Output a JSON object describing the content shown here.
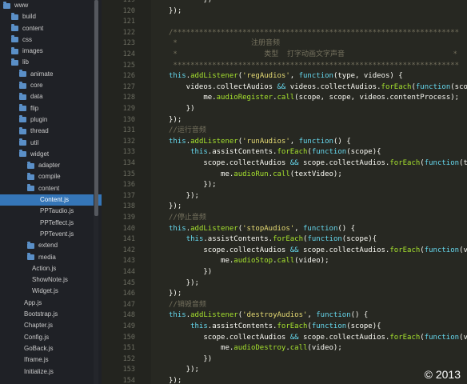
{
  "sidebar": {
    "items": [
      {
        "label": "www",
        "type": "folder",
        "depth": 0,
        "selected": false
      },
      {
        "label": "build",
        "type": "folder",
        "depth": 1,
        "selected": false
      },
      {
        "label": "content",
        "type": "folder",
        "depth": 1,
        "selected": false
      },
      {
        "label": "css",
        "type": "folder",
        "depth": 1,
        "selected": false
      },
      {
        "label": "images",
        "type": "folder",
        "depth": 1,
        "selected": false
      },
      {
        "label": "lib",
        "type": "folder",
        "depth": 1,
        "selected": false
      },
      {
        "label": "animate",
        "type": "folder",
        "depth": 2,
        "selected": false
      },
      {
        "label": "core",
        "type": "folder",
        "depth": 2,
        "selected": false
      },
      {
        "label": "data",
        "type": "folder",
        "depth": 2,
        "selected": false
      },
      {
        "label": "flip",
        "type": "folder",
        "depth": 2,
        "selected": false
      },
      {
        "label": "plugin",
        "type": "folder",
        "depth": 2,
        "selected": false
      },
      {
        "label": "thread",
        "type": "folder",
        "depth": 2,
        "selected": false
      },
      {
        "label": "util",
        "type": "folder",
        "depth": 2,
        "selected": false
      },
      {
        "label": "widget",
        "type": "folder",
        "depth": 2,
        "selected": false
      },
      {
        "label": "adapter",
        "type": "folder",
        "depth": 3,
        "selected": false
      },
      {
        "label": "compile",
        "type": "folder",
        "depth": 3,
        "selected": false
      },
      {
        "label": "content",
        "type": "folder",
        "depth": 3,
        "selected": false
      },
      {
        "label": "Content.js",
        "type": "file",
        "depth": 4,
        "selected": true
      },
      {
        "label": "PPTaudio.js",
        "type": "file",
        "depth": 4,
        "selected": false
      },
      {
        "label": "PPTeffect.js",
        "type": "file",
        "depth": 4,
        "selected": false
      },
      {
        "label": "PPTevent.js",
        "type": "file",
        "depth": 4,
        "selected": false
      },
      {
        "label": "extend",
        "type": "folder",
        "depth": 3,
        "selected": false
      },
      {
        "label": "media",
        "type": "folder",
        "depth": 3,
        "selected": false
      },
      {
        "label": "Action.js",
        "type": "file",
        "depth": 3,
        "selected": false
      },
      {
        "label": "ShowNote.js",
        "type": "file",
        "depth": 3,
        "selected": false
      },
      {
        "label": "Widget.js",
        "type": "file",
        "depth": 3,
        "selected": false
      },
      {
        "label": "App.js",
        "type": "file",
        "depth": 2,
        "selected": false
      },
      {
        "label": "Bootstrap.js",
        "type": "file",
        "depth": 2,
        "selected": false
      },
      {
        "label": "Chapter.js",
        "type": "file",
        "depth": 2,
        "selected": false
      },
      {
        "label": "Config.js",
        "type": "file",
        "depth": 2,
        "selected": false
      },
      {
        "label": "GoBack.js",
        "type": "file",
        "depth": 2,
        "selected": false
      },
      {
        "label": "Iframe.js",
        "type": "file",
        "depth": 2,
        "selected": false
      },
      {
        "label": "Initialize.js",
        "type": "file",
        "depth": 2,
        "selected": false
      }
    ]
  },
  "editor": {
    "lines": [
      {
        "num": "119",
        "tokens": [
          [
            "plain",
            "        })"
          ]
        ]
      },
      {
        "num": "120",
        "tokens": [
          [
            "plain",
            "});"
          ]
        ]
      },
      {
        "num": "121",
        "tokens": [
          [
            "plain",
            ""
          ]
        ]
      },
      {
        "num": "122",
        "tokens": [
          [
            "cmt",
            "/******************************************************************"
          ]
        ]
      },
      {
        "num": "123",
        "tokens": [
          [
            "cmt",
            " *                 注册音频"
          ]
        ]
      },
      {
        "num": "124",
        "tokens": [
          [
            "cmt",
            " *                    类型  打字动画文字声音                         *"
          ]
        ]
      },
      {
        "num": "125",
        "tokens": [
          [
            "cmt",
            " ******************************************************************"
          ]
        ]
      },
      {
        "num": "126",
        "tokens": [
          [
            "kw",
            "this"
          ],
          [
            "plain",
            "."
          ],
          [
            "fn",
            "addListener"
          ],
          [
            "plain",
            "("
          ],
          [
            "str",
            "'regAudios'"
          ],
          [
            "plain",
            ", "
          ],
          [
            "kw",
            "function"
          ],
          [
            "plain",
            "(type, videos) {"
          ]
        ]
      },
      {
        "num": "127",
        "tokens": [
          [
            "plain",
            "    videos.collectAudios "
          ],
          [
            "kw",
            "&&"
          ],
          [
            "plain",
            " videos.collectAudios."
          ],
          [
            "fn",
            "forEach"
          ],
          [
            "plain",
            "("
          ],
          [
            "kw",
            "function"
          ],
          [
            "plain",
            "(scope"
          ]
        ]
      },
      {
        "num": "128",
        "tokens": [
          [
            "plain",
            "        me."
          ],
          [
            "fn",
            "audioRegister"
          ],
          [
            "plain",
            "."
          ],
          [
            "fn",
            "call"
          ],
          [
            "plain",
            "(scope, scope, videos.contentProcess);"
          ]
        ]
      },
      {
        "num": "129",
        "tokens": [
          [
            "plain",
            "    })"
          ]
        ]
      },
      {
        "num": "130",
        "tokens": [
          [
            "plain",
            "});"
          ]
        ]
      },
      {
        "num": "131",
        "tokens": [
          [
            "cmt",
            "//运行音频"
          ]
        ]
      },
      {
        "num": "132",
        "tokens": [
          [
            "kw",
            "this"
          ],
          [
            "plain",
            "."
          ],
          [
            "fn",
            "addListener"
          ],
          [
            "plain",
            "("
          ],
          [
            "str",
            "'runAudios'"
          ],
          [
            "plain",
            ", "
          ],
          [
            "kw",
            "function"
          ],
          [
            "plain",
            "() {"
          ]
        ]
      },
      {
        "num": "133",
        "tokens": [
          [
            "plain",
            "     "
          ],
          [
            "kw",
            "this"
          ],
          [
            "plain",
            ".assistContents."
          ],
          [
            "fn",
            "forEach"
          ],
          [
            "plain",
            "("
          ],
          [
            "kw",
            "function"
          ],
          [
            "plain",
            "(scope){"
          ]
        ]
      },
      {
        "num": "134",
        "tokens": [
          [
            "plain",
            "        scope.collectAudios "
          ],
          [
            "kw",
            "&&"
          ],
          [
            "plain",
            " scope.collectAudios."
          ],
          [
            "fn",
            "forEach"
          ],
          [
            "plain",
            "("
          ],
          [
            "kw",
            "function"
          ],
          [
            "plain",
            "(t"
          ]
        ]
      },
      {
        "num": "135",
        "tokens": [
          [
            "plain",
            "            me."
          ],
          [
            "fn",
            "audioRun"
          ],
          [
            "plain",
            "."
          ],
          [
            "fn",
            "call"
          ],
          [
            "plain",
            "(textVideo);"
          ]
        ]
      },
      {
        "num": "136",
        "tokens": [
          [
            "plain",
            "        });"
          ]
        ]
      },
      {
        "num": "137",
        "tokens": [
          [
            "plain",
            "    });"
          ]
        ]
      },
      {
        "num": "138",
        "tokens": [
          [
            "plain",
            "});"
          ]
        ]
      },
      {
        "num": "139",
        "tokens": [
          [
            "cmt",
            "//停止音频"
          ]
        ]
      },
      {
        "num": "140",
        "tokens": [
          [
            "kw",
            "this"
          ],
          [
            "plain",
            "."
          ],
          [
            "fn",
            "addListener"
          ],
          [
            "plain",
            "("
          ],
          [
            "str",
            "'stopAudios'"
          ],
          [
            "plain",
            ", "
          ],
          [
            "kw",
            "function"
          ],
          [
            "plain",
            "() {"
          ]
        ]
      },
      {
        "num": "141",
        "tokens": [
          [
            "plain",
            "    "
          ],
          [
            "kw",
            "this"
          ],
          [
            "plain",
            ".assistContents."
          ],
          [
            "fn",
            "forEach"
          ],
          [
            "plain",
            "("
          ],
          [
            "kw",
            "function"
          ],
          [
            "plain",
            "(scope){"
          ]
        ]
      },
      {
        "num": "142",
        "tokens": [
          [
            "plain",
            "        scope.collectAudios "
          ],
          [
            "kw",
            "&&"
          ],
          [
            "plain",
            " scope.collectAudios."
          ],
          [
            "fn",
            "forEach"
          ],
          [
            "plain",
            "("
          ],
          [
            "kw",
            "function"
          ],
          [
            "plain",
            "(v"
          ]
        ]
      },
      {
        "num": "143",
        "tokens": [
          [
            "plain",
            "            me."
          ],
          [
            "fn",
            "audioStop"
          ],
          [
            "plain",
            "."
          ],
          [
            "fn",
            "call"
          ],
          [
            "plain",
            "(video);"
          ]
        ]
      },
      {
        "num": "144",
        "tokens": [
          [
            "plain",
            "        })"
          ]
        ]
      },
      {
        "num": "145",
        "tokens": [
          [
            "plain",
            "    });"
          ]
        ]
      },
      {
        "num": "146",
        "tokens": [
          [
            "plain",
            "});"
          ]
        ]
      },
      {
        "num": "147",
        "tokens": [
          [
            "cmt",
            "//销毁音频"
          ]
        ]
      },
      {
        "num": "148",
        "tokens": [
          [
            "kw",
            "this"
          ],
          [
            "plain",
            "."
          ],
          [
            "fn",
            "addListener"
          ],
          [
            "plain",
            "("
          ],
          [
            "str",
            "'destroyAudios'"
          ],
          [
            "plain",
            ", "
          ],
          [
            "kw",
            "function"
          ],
          [
            "plain",
            "() {"
          ]
        ]
      },
      {
        "num": "149",
        "tokens": [
          [
            "plain",
            "     "
          ],
          [
            "kw",
            "this"
          ],
          [
            "plain",
            ".assistContents."
          ],
          [
            "fn",
            "forEach"
          ],
          [
            "plain",
            "("
          ],
          [
            "kw",
            "function"
          ],
          [
            "plain",
            "(scope){"
          ]
        ]
      },
      {
        "num": "150",
        "tokens": [
          [
            "plain",
            "        scope.collectAudios "
          ],
          [
            "kw",
            "&&"
          ],
          [
            "plain",
            " scope.collectAudios."
          ],
          [
            "fn",
            "forEach"
          ],
          [
            "plain",
            "("
          ],
          [
            "kw",
            "function"
          ],
          [
            "plain",
            "(v"
          ]
        ]
      },
      {
        "num": "151",
        "tokens": [
          [
            "plain",
            "            me."
          ],
          [
            "fn",
            "audioDestroy"
          ],
          [
            "plain",
            "."
          ],
          [
            "fn",
            "call"
          ],
          [
            "plain",
            "(video);"
          ]
        ]
      },
      {
        "num": "152",
        "tokens": [
          [
            "plain",
            "        })"
          ]
        ]
      },
      {
        "num": "153",
        "tokens": [
          [
            "plain",
            "    });"
          ]
        ]
      },
      {
        "num": "154",
        "tokens": [
          [
            "plain",
            "});"
          ]
        ]
      }
    ]
  },
  "footer": {
    "copyright": "© 2013"
  },
  "colors": {
    "sidebar_bg": "#1f2126",
    "selected_bg": "#3576b8",
    "folder_icon": "#5a8fc7",
    "editor_bg": "#272822",
    "keyword": "#66d9ef",
    "function": "#a6e22e",
    "string": "#e6db74",
    "comment": "#75715e",
    "plain": "#f8f8f2"
  }
}
